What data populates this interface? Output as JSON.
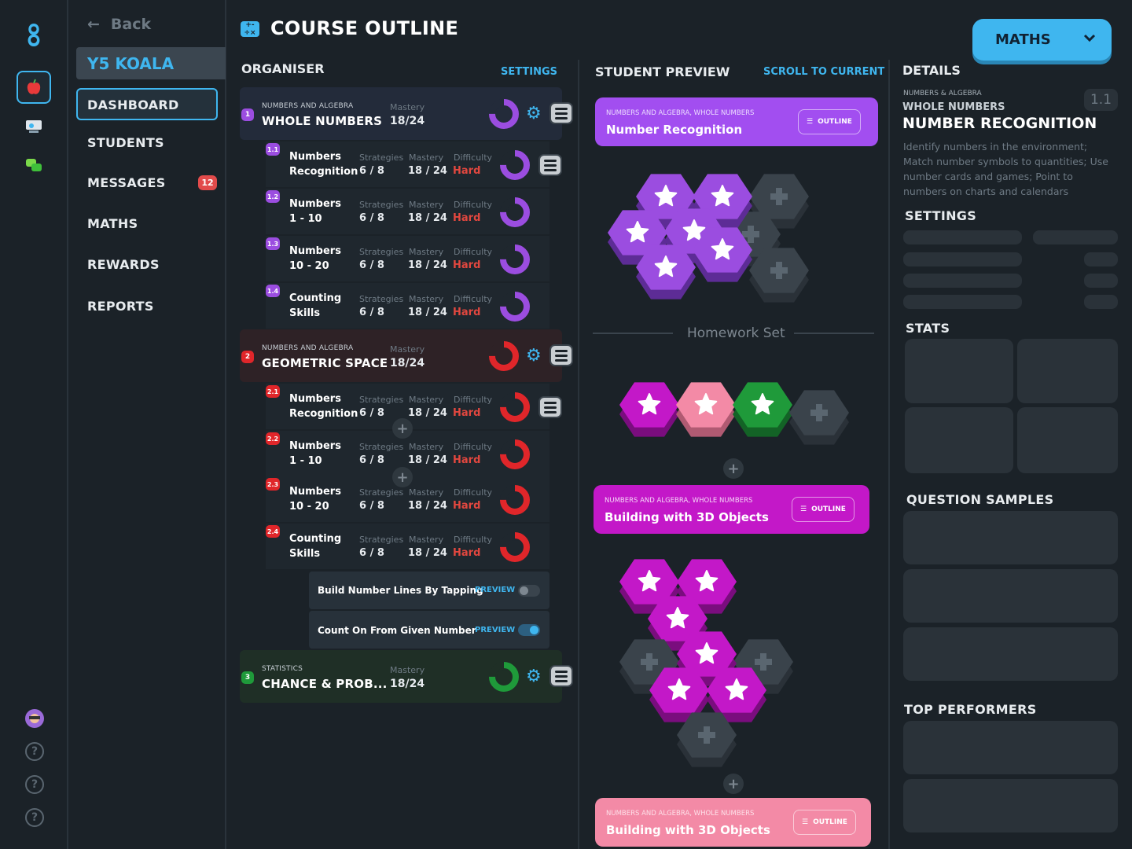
{
  "app": {
    "page_title": "COURSE OUTLINE",
    "subject_dropdown": "MATHS"
  },
  "nav": {
    "back": "Back",
    "class_name": "Y5 KOALA",
    "items": [
      "DASHBOARD",
      "STUDENTS",
      "MESSAGES",
      "MATHS",
      "REWARDS",
      "REPORTS"
    ],
    "messages_badge": "12"
  },
  "organiser": {
    "title": "ORGANISER",
    "settings": "SETTINGS",
    "sections": [
      {
        "num": "1",
        "category": "NUMBERS AND ALGEBRA",
        "title": "WHOLE NUMBERS",
        "mastery_label": "Mastery",
        "mastery": "18/24",
        "mastery_fraction": 0.75,
        "color": "#9b4de0",
        "rows": [
          {
            "badge": "1.1",
            "name1": "Numbers",
            "name2": "Recognition",
            "strategies": "6 / 8",
            "mastery": "18 / 24",
            "difficulty": "Hard"
          },
          {
            "badge": "1.2",
            "name1": "Numbers",
            "name2": "1 - 10",
            "strategies": "6 / 8",
            "mastery": "18 / 24",
            "difficulty": "Hard"
          },
          {
            "badge": "1.3",
            "name1": "Numbers",
            "name2": "10 - 20",
            "strategies": "6 / 8",
            "mastery": "18 / 24",
            "difficulty": "Hard"
          },
          {
            "badge": "1.4",
            "name1": "Counting",
            "name2": "Skills",
            "strategies": "6 / 8",
            "mastery": "18 / 24",
            "difficulty": "Hard"
          }
        ]
      },
      {
        "num": "2",
        "category": "NUMBERS AND ALGEBRA",
        "title": "GEOMETRIC SPACE",
        "mastery_label": "Mastery",
        "mastery": "18/24",
        "mastery_fraction": 0.75,
        "color": "#e0262a",
        "rows": [
          {
            "badge": "2.1",
            "name1": "Numbers",
            "name2": "Recognition",
            "strategies": "6 / 8",
            "mastery": "18 / 24",
            "difficulty": "Hard"
          },
          {
            "badge": "2.2",
            "name1": "Numbers",
            "name2": "1 - 10",
            "strategies": "6 / 8",
            "mastery": "18 / 24",
            "difficulty": "Hard"
          },
          {
            "badge": "2.3",
            "name1": "Numbers",
            "name2": "10 - 20",
            "strategies": "6 / 8",
            "mastery": "18 / 24",
            "difficulty": "Hard"
          },
          {
            "badge": "2.4",
            "name1": "Counting",
            "name2": "Skills",
            "strategies": "6 / 8",
            "mastery": "18 / 24",
            "difficulty": "Hard"
          }
        ]
      },
      {
        "num": "3",
        "category": "STATISTICS",
        "title": "CHANCE & PROB...",
        "mastery_label": "Mastery",
        "mastery": "18/24",
        "mastery_fraction": 0.75,
        "color": "#1f9a3a",
        "rows": []
      }
    ],
    "col_labels": {
      "strategies": "Strategies",
      "mastery": "Mastery",
      "difficulty": "Difficulty"
    },
    "activities": [
      {
        "name": "Build Number Lines By Tapping",
        "preview": "PREVIEW",
        "toggled": false
      },
      {
        "name": "Count On From Given Number",
        "preview": "PREVIEW",
        "toggled": true
      }
    ]
  },
  "preview": {
    "title": "STUDENT PREVIEW",
    "scroll": "SCROLL TO CURRENT",
    "homework": "Homework Set",
    "cards": [
      {
        "category": "NUMBERS AND ALGEBRA, WHOLE NUMBERS",
        "name": "Number Recognition",
        "button": "OUTLINE",
        "color": "#a24ef0"
      },
      {
        "category": "NUMBERS AND ALGEBRA, WHOLE NUMBERS",
        "name": "Building with 3D Objects",
        "button": "OUTLINE",
        "color": "#c318c8"
      },
      {
        "category": "NUMBERS AND ALGEBRA, WHOLE NUMBERS",
        "name": "Building with 3D Objects",
        "button": "OUTLINE",
        "color": "#f38aa6"
      }
    ]
  },
  "details": {
    "title": "DETAILS",
    "category": "NUMBERS & ALGEBRA",
    "subcategory": "WHOLE NUMBERS",
    "name": "NUMBER RECOGNITION",
    "code": "1.1",
    "description": "Identify numbers in the environment; Match number symbols to quantities; Use number cards and games; Point to numbers on charts and calendars",
    "settings": "SETTINGS",
    "stats": "STATS",
    "question_samples": "QUESTION SAMPLES",
    "top_performers": "TOP PERFORMERS"
  },
  "colors": {
    "accent": "#3fb6ef",
    "purple": "#9b4de0",
    "red": "#e0262a",
    "green": "#1f9a3a",
    "magenta": "#c318c8",
    "pink": "#f38aa6"
  }
}
